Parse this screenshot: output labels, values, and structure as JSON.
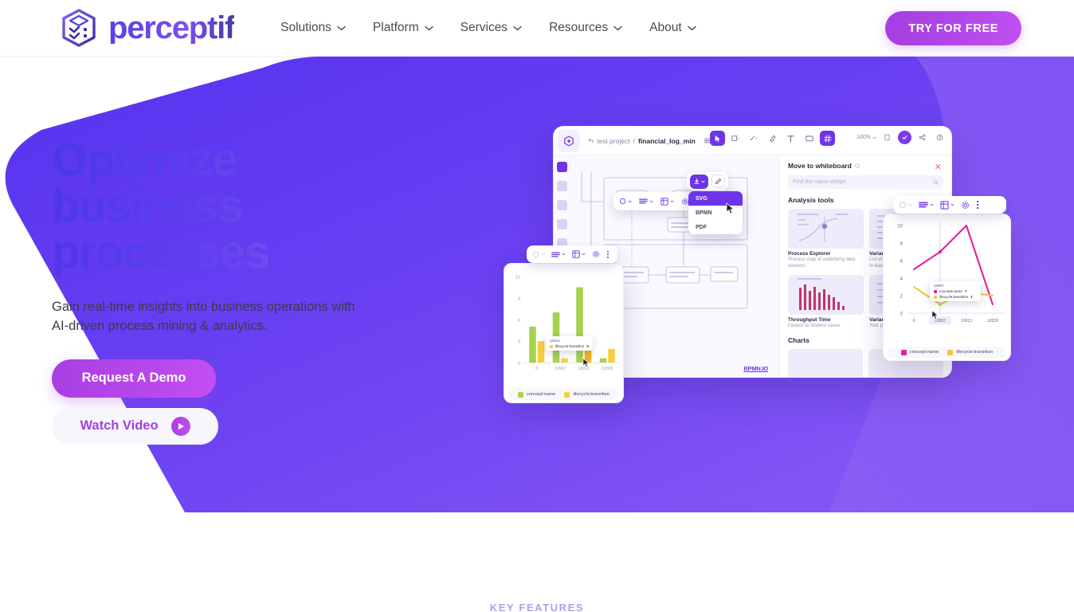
{
  "brand": {
    "name": "perceptif",
    "logo_icon": "cube-logo-icon"
  },
  "nav": {
    "items": [
      {
        "label": "Solutions",
        "icon": "chevron-down-icon"
      },
      {
        "label": "Platform",
        "icon": "chevron-down-icon"
      },
      {
        "label": "Services",
        "icon": "chevron-down-icon"
      },
      {
        "label": "Resources",
        "icon": "chevron-down-icon"
      },
      {
        "label": "About",
        "icon": "chevron-down-icon"
      }
    ],
    "cta": "TRY FOR FREE"
  },
  "hero": {
    "heading_line1": "Optimize",
    "heading_line2": "business",
    "heading_line3": "processes",
    "subheading": "Gain real-time insights into business operations with AI-driven process mining & analytics.",
    "primary_button": "Request A Demo",
    "secondary_button": "Watch Video",
    "play_icon": "play-icon"
  },
  "section_label": "KEY FEATURES",
  "app": {
    "breadcrumb_parent": "test project",
    "breadcrumb_sep": "/",
    "breadcrumb_current": "financial_log_min",
    "zoom_level": "100%",
    "toolbar_icons": [
      "cursor-icon",
      "rectangle-icon",
      "line-icon",
      "eraser-icon",
      "text-icon",
      "image-icon",
      "grid-icon"
    ],
    "right_icons": [
      "note-icon",
      "check-icon",
      "share-icon",
      "help-icon"
    ],
    "canvas_watermark": "BPMN.IO",
    "download_menu": {
      "options": [
        "SVG",
        "BPMN",
        "PDF"
      ],
      "selected": "SVG"
    },
    "panel": {
      "title": "Move to whiteboard",
      "search_placeholder": "Find the name widget",
      "section_analysis": "Analysis tools",
      "section_charts": "Charts",
      "tools": [
        {
          "name": "Process Explorer",
          "desc": "Process map of underlying data streams"
        },
        {
          "name": "Variant Explorer",
          "desc": "List of process variants from most to least common"
        },
        {
          "name": "Throughput Time",
          "desc": "Fastest to slowest cases"
        },
        {
          "name": "Variant Explorer",
          "desc": "Your process variants"
        }
      ]
    }
  },
  "colors": {
    "brand_purple": "#5b3fe8",
    "accent_magenta": "#b546e9",
    "hero_shape": "#5e3ff0",
    "chart_green": "#a5d34f",
    "chart_yellow": "#f5cf3e",
    "chart_pink": "#e61fa0",
    "chart_gold": "#f0c93a"
  },
  "chart_data": [
    {
      "type": "bar",
      "title": "",
      "categories": [
        "0",
        "10997",
        "10913",
        "12029"
      ],
      "series": [
        {
          "name": "concept:name",
          "values": [
            5,
            7,
            10.5,
            0.6
          ],
          "color": "#a5d34f"
        },
        {
          "name": "lifecycle:transition",
          "values": [
            3,
            0.6,
            3,
            1.9
          ],
          "color": "#f5cf3e"
        }
      ],
      "ylabel": "",
      "xlabel": "",
      "yticks": [
        0,
        3,
        6,
        9,
        12
      ],
      "ylim": [
        0,
        12
      ],
      "grid": false,
      "legend_position": "bottom",
      "tooltip": {
        "title": "10913",
        "rows": [
          {
            "label": "lifecycle:transition",
            "value": "3"
          }
        ]
      }
    },
    {
      "type": "line",
      "title": "",
      "x": [
        "0",
        "10997",
        "10913",
        "12029"
      ],
      "series": [
        {
          "name": "concept:name",
          "values": [
            5,
            7,
            10,
            1
          ],
          "color": "#e61fa0"
        },
        {
          "name": "lifecycle:transition",
          "values": [
            3,
            1,
            2.4,
            2
          ],
          "color": "#f0c93a"
        }
      ],
      "ylabel": "",
      "xlabel": "",
      "yticks": [
        0,
        2,
        4,
        6,
        8,
        10
      ],
      "ylim": [
        0,
        10
      ],
      "grid": false,
      "legend_position": "bottom",
      "tooltip": {
        "title": "10997",
        "rows": [
          {
            "label": "concept:name",
            "value": "7"
          },
          {
            "label": "lifecycle:transition",
            "value": "1"
          }
        ]
      }
    }
  ]
}
